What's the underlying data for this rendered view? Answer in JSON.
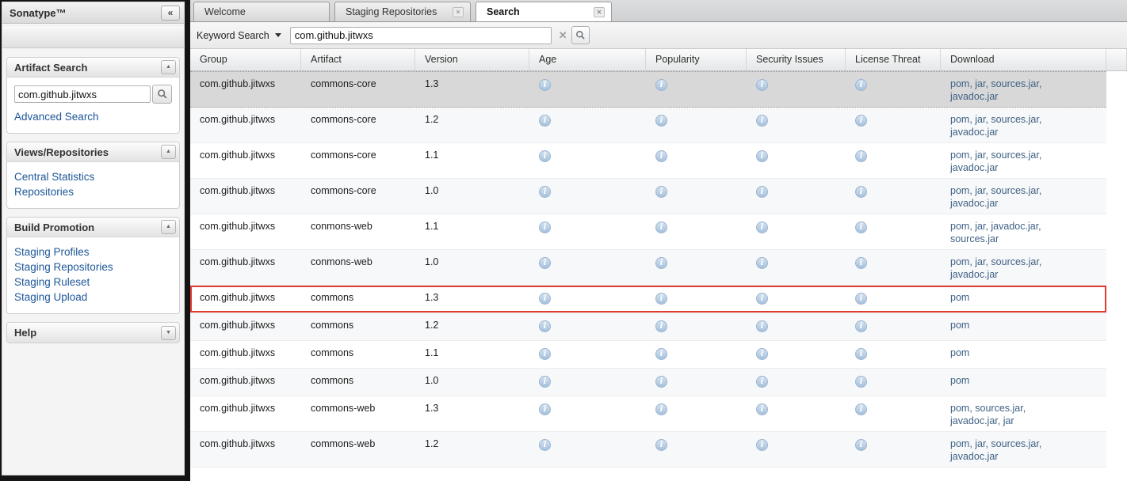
{
  "sidebar": {
    "title": "Sonatype™",
    "collapse_icon": "«",
    "panels": {
      "artifact_search": {
        "title": "Artifact Search",
        "search_value": "com.github.jitwxs",
        "advanced_search_label": "Advanced Search"
      },
      "views_repositories": {
        "title": "Views/Repositories",
        "links": [
          "Central Statistics",
          "Repositories"
        ]
      },
      "build_promotion": {
        "title": "Build Promotion",
        "links": [
          "Staging Profiles",
          "Staging Repositories",
          "Staging Ruleset",
          "Staging Upload"
        ]
      },
      "help": {
        "title": "Help"
      }
    }
  },
  "tabs": [
    {
      "label": "Welcome",
      "closable": false,
      "active": false
    },
    {
      "label": "Staging Repositories",
      "closable": true,
      "active": false
    },
    {
      "label": "Search",
      "closable": true,
      "active": true
    }
  ],
  "search_toolbar": {
    "mode_label": "Keyword Search",
    "query": "com.github.jitwxs",
    "clear_icon": "✕"
  },
  "results_table": {
    "columns": [
      "Group",
      "Artifact",
      "Version",
      "Age",
      "Popularity",
      "Security Issues",
      "License Threat",
      "Download"
    ],
    "rows": [
      {
        "group": "com.github.jitwxs",
        "artifact": "commons-core",
        "version": "1.3",
        "download": "pom, jar, sources.jar, javadoc.jar",
        "selected": true,
        "highlighted": false
      },
      {
        "group": "com.github.jitwxs",
        "artifact": "commons-core",
        "version": "1.2",
        "download": "pom, jar, sources.jar, javadoc.jar",
        "selected": false,
        "highlighted": false
      },
      {
        "group": "com.github.jitwxs",
        "artifact": "commons-core",
        "version": "1.1",
        "download": "pom, jar, sources.jar, javadoc.jar",
        "selected": false,
        "highlighted": false
      },
      {
        "group": "com.github.jitwxs",
        "artifact": "commons-core",
        "version": "1.0",
        "download": "pom, jar, sources.jar, javadoc.jar",
        "selected": false,
        "highlighted": false
      },
      {
        "group": "com.github.jitwxs",
        "artifact": "conmons-web",
        "version": "1.1",
        "download": "pom, jar, javadoc.jar, sources.jar",
        "selected": false,
        "highlighted": false
      },
      {
        "group": "com.github.jitwxs",
        "artifact": "conmons-web",
        "version": "1.0",
        "download": "pom, jar, sources.jar, javadoc.jar",
        "selected": false,
        "highlighted": false
      },
      {
        "group": "com.github.jitwxs",
        "artifact": "commons",
        "version": "1.3",
        "download": "pom",
        "selected": false,
        "highlighted": true
      },
      {
        "group": "com.github.jitwxs",
        "artifact": "commons",
        "version": "1.2",
        "download": "pom",
        "selected": false,
        "highlighted": false
      },
      {
        "group": "com.github.jitwxs",
        "artifact": "commons",
        "version": "1.1",
        "download": "pom",
        "selected": false,
        "highlighted": false
      },
      {
        "group": "com.github.jitwxs",
        "artifact": "commons",
        "version": "1.0",
        "download": "pom",
        "selected": false,
        "highlighted": false
      },
      {
        "group": "com.github.jitwxs",
        "artifact": "commons-web",
        "version": "1.3",
        "download": "pom, sources.jar, javadoc.jar, jar",
        "selected": false,
        "highlighted": false
      },
      {
        "group": "com.github.jitwxs",
        "artifact": "commons-web",
        "version": "1.2",
        "download": "pom, jar, sources.jar, javadoc.jar",
        "selected": false,
        "highlighted": false
      }
    ]
  },
  "colors": {
    "selection_bg": "#d8d8d8",
    "row_highlight_border": "#e03b30",
    "sidebar_link": "#1e5799",
    "download_link": "#3f6185",
    "info_icon_fill": "#a6c1dc"
  }
}
